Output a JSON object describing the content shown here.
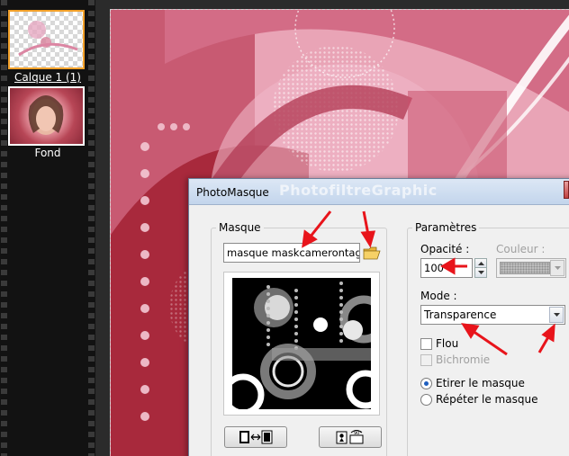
{
  "layers": {
    "items": [
      {
        "label": "Calque 1 (1)",
        "selected": true
      },
      {
        "label": "Fond",
        "selected": false
      }
    ]
  },
  "dialog": {
    "title": "PhotoMasque",
    "watermark": "PhotofiltreGraphic",
    "masque": {
      "group_label": "Masque",
      "file_value": "masque maskcamerontags_"
    },
    "params": {
      "group_label": "Paramètres",
      "opacity_label": "Opacité :",
      "opacity_value": "100",
      "color_label": "Couleur :",
      "mode_label": "Mode :",
      "mode_value": "Transparence",
      "flou_label": "Flou",
      "bichromie_label": "Bichromie",
      "stretch_label": "Etirer le masque",
      "repeat_label": "Répéter le masque"
    }
  },
  "colors": {
    "annotation_arrow": "#e8141b",
    "selection_border": "#f3a12a",
    "radio_dot": "#1f5fbf"
  }
}
